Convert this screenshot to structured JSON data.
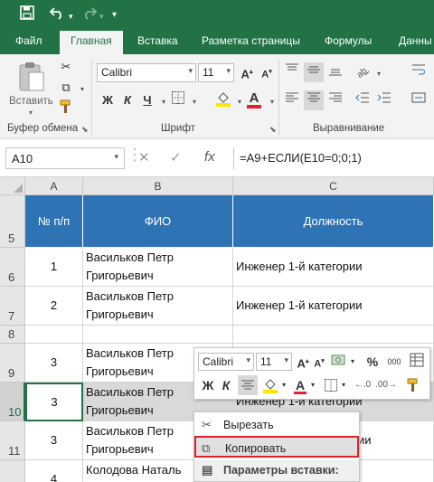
{
  "qat": {
    "save_icon": "save-icon",
    "undo_icon": "undo-icon",
    "redo_icon": "redo-icon",
    "customize_icon": "customize-icon"
  },
  "tabs": [
    {
      "label": "Файл"
    },
    {
      "label": "Главная",
      "active": true
    },
    {
      "label": "Вставка"
    },
    {
      "label": "Разметка страницы"
    },
    {
      "label": "Формулы"
    },
    {
      "label": "Данны"
    }
  ],
  "ribbon": {
    "clipboard": {
      "paste_label": "Вставить",
      "group_label": "Буфер обмена"
    },
    "font": {
      "font_name": "Calibri",
      "font_size": "11",
      "bold": "Ж",
      "italic": "К",
      "underline": "Ч",
      "group_label": "Шрифт"
    },
    "alignment": {
      "group_label": "Выравнивание"
    }
  },
  "formula_bar": {
    "name_box": "A10",
    "cancel": "✕",
    "enter": "✓",
    "fx": "fx",
    "formula": "=A9+ЕСЛИ(E10=0;0;1)"
  },
  "columns": [
    {
      "label": "A",
      "selected": false
    },
    {
      "label": "B",
      "selected": false
    },
    {
      "label": "C",
      "selected": false
    }
  ],
  "table": {
    "headers": [
      "№ п/п",
      "ФИО",
      "Должность"
    ],
    "rows": [
      {
        "row": "5",
        "a": "№ п/п",
        "b": "ФИО",
        "c": "Должность"
      },
      {
        "row": "6",
        "a": "1",
        "b": "Васильков Петр Григорьевич",
        "c": "Инженер 1-й категории"
      },
      {
        "row": "7",
        "a": "2",
        "b": "Васильков Петр Григорьевич",
        "c": "Инженер 1-й категории"
      },
      {
        "row": "8",
        "a": "",
        "b": "",
        "c": ""
      },
      {
        "row": "9",
        "a": "3",
        "b": "Васильков Петр Григорьевич",
        "c": ""
      },
      {
        "row": "10",
        "a": "3",
        "b": "Васильков Петр Григорьевич",
        "c": "Инженер 1-й категории"
      },
      {
        "row": "11",
        "a": "3",
        "b": "Васильков Петр Григорьевич",
        "c": "ии"
      },
      {
        "row": "12",
        "a": "4",
        "b": "Колодова Наталь",
        "c": ""
      }
    ]
  },
  "mini_toolbar": {
    "font_name": "Calibri",
    "font_size": "11",
    "bold": "Ж",
    "italic": "К",
    "percent": "%",
    "thousands": "000"
  },
  "context_menu": {
    "cut": "Вырезать",
    "copy": "Копировать",
    "paste_options": "Параметры вставки:"
  },
  "colors": {
    "excel_green": "#217346",
    "header_blue": "#2e74b5",
    "highlight_red": "#e0232a"
  }
}
